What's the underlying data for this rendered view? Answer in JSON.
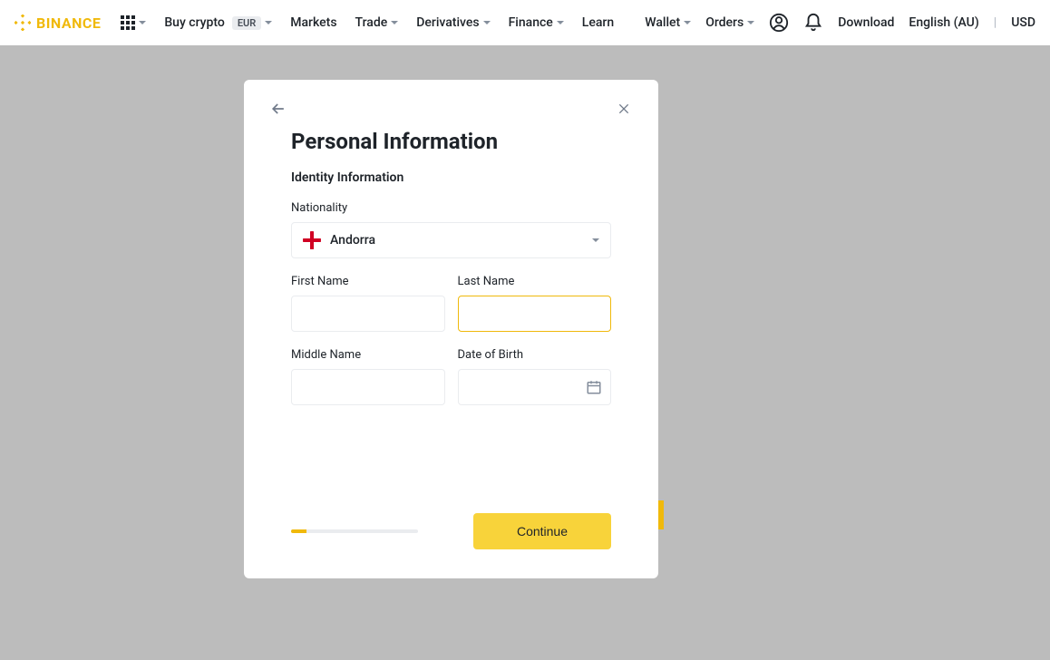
{
  "nav": {
    "logo_text": "BINANCE",
    "buy_crypto": "Buy crypto",
    "currency_chip": "EUR",
    "markets": "Markets",
    "trade": "Trade",
    "derivatives": "Derivatives",
    "finance": "Finance",
    "learn": "Learn",
    "wallet": "Wallet",
    "orders": "Orders",
    "download": "Download",
    "locale": "English (AU)",
    "currency": "USD"
  },
  "modal": {
    "title": "Personal Information",
    "section": "Identity Information",
    "nationality_label": "Nationality",
    "nationality_value": "Andorra",
    "first_name_label": "First Name",
    "first_name_value": "",
    "last_name_label": "Last Name",
    "last_name_value": "",
    "middle_name_label": "Middle Name",
    "middle_name_value": "",
    "dob_label": "Date of Birth",
    "dob_value": "",
    "continue": "Continue",
    "progress_percent": 12
  }
}
